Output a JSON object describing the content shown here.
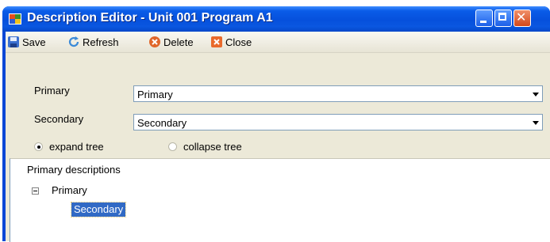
{
  "window": {
    "title": "Description Editor - Unit 001 Program A1",
    "controls": [
      "minimize",
      "maximize",
      "close"
    ]
  },
  "toolbar": {
    "save_label": "Save",
    "refresh_label": "Refresh",
    "delete_label": "Delete",
    "close_label": "Close"
  },
  "form": {
    "primary_label": "Primary",
    "primary_value": "Primary",
    "secondary_label": "Secondary",
    "secondary_value": "Secondary",
    "expand_label": "expand tree",
    "collapse_label": "collapse tree",
    "selected_option": "expand tree"
  },
  "tree": {
    "title": "Primary descriptions",
    "root": "Primary",
    "child": "Secondary"
  },
  "colors": {
    "title_bar": "#0650dc",
    "selection": "#316ac5",
    "panel": "#ece9d8"
  }
}
